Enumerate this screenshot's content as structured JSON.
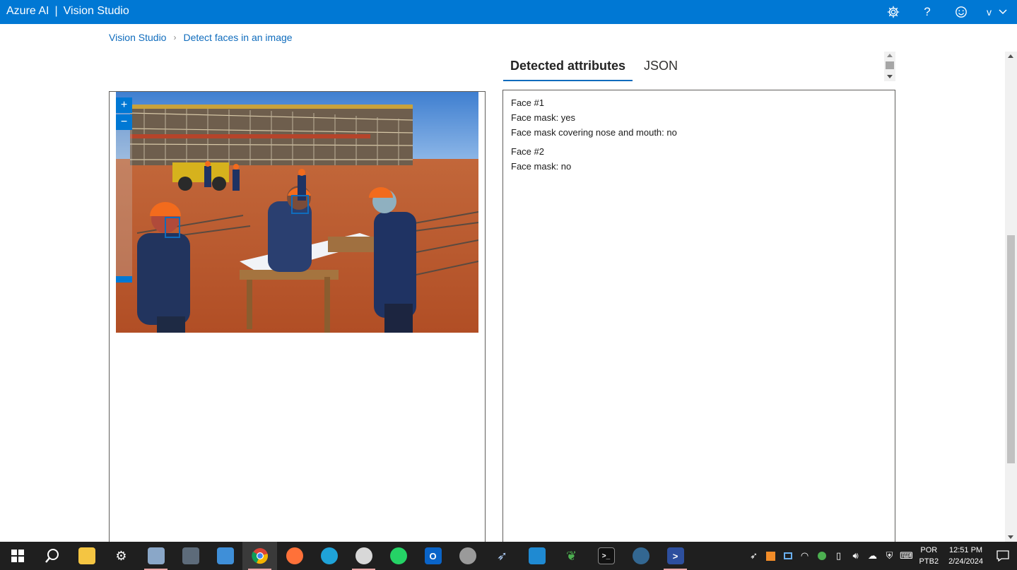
{
  "header": {
    "brand": "Azure AI",
    "separator": "|",
    "product": "Vision Studio",
    "icons": [
      "gear-icon",
      "help-icon",
      "feedback-smiley-icon"
    ],
    "help_glyph": "?",
    "user_initial": "v"
  },
  "breadcrumb": {
    "items": [
      "Vision Studio",
      "Detect faces in an image"
    ]
  },
  "tabs": [
    {
      "label": "Detected attributes",
      "active": true
    },
    {
      "label": "JSON",
      "active": false
    }
  ],
  "image_controls": {
    "zoom_in": "+",
    "zoom_out": "−"
  },
  "faces": [
    {
      "title": "Face #1",
      "attributes": [
        "Face mask: yes",
        "Face mask covering nose and mouth: no"
      ]
    },
    {
      "title": "Face #2",
      "attributes": [
        "Face mask: no"
      ]
    }
  ],
  "taskbar": {
    "apps": [
      "start-icon",
      "search-icon",
      "file-explorer-icon",
      "settings-icon",
      "photos-icon",
      "calculator-icon",
      "store-icon",
      "chrome-icon",
      "firefox-icon",
      "edge-icon",
      "paint-icon",
      "whatsapp-icon",
      "outlook-icon",
      "app-icon",
      "rocket-icon",
      "vscode-icon",
      "mongodb-icon",
      "terminal-icon",
      "postgres-icon",
      "powershell-icon"
    ],
    "language": {
      "line1": "POR",
      "line2": "PTB2"
    },
    "clock": {
      "time": "12:51 PM",
      "date": "2/24/2024"
    }
  },
  "colors": {
    "header_bg": "#0078d4",
    "link": "#0f6cbd",
    "face_box": "#0f6cbd"
  }
}
